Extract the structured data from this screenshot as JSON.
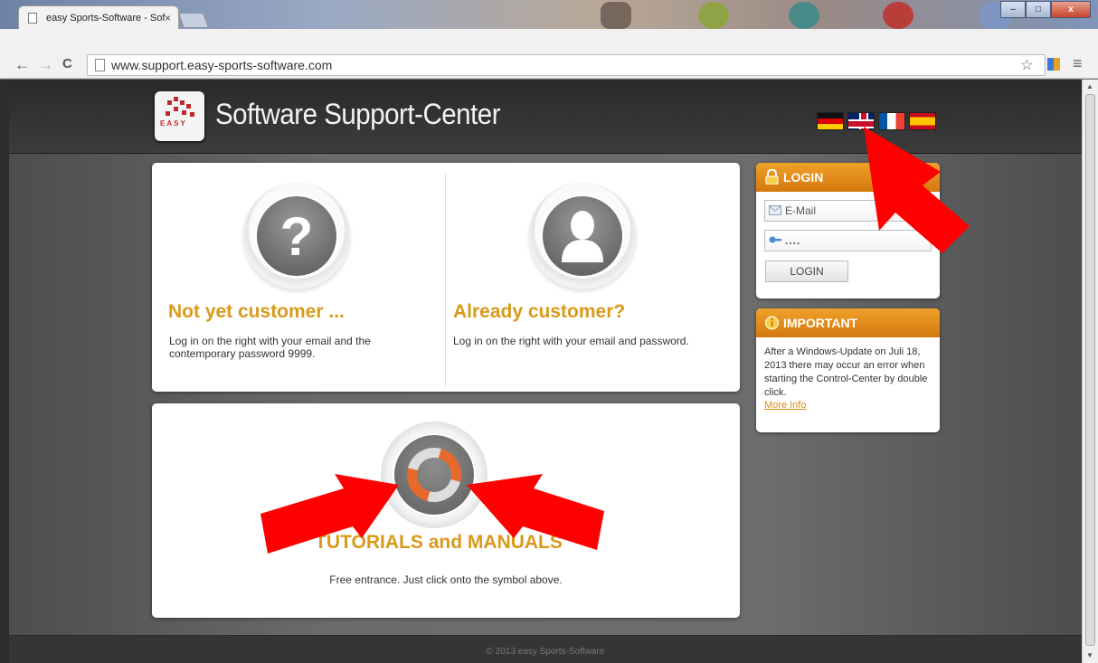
{
  "browser": {
    "tab_title": "easy Sports-Software - Sof",
    "tab_close": "×",
    "url": "www.support.easy-sports-software.com",
    "window_buttons": {
      "minimize": "–",
      "maximize": "□",
      "close": "x"
    },
    "nav": {
      "back": "←",
      "forward": "→",
      "reload": "C"
    },
    "toolbar_icons": {
      "bookmark": "☆",
      "menu": "≡"
    }
  },
  "header": {
    "logo_text": "EASY",
    "title": "Software Support-Center",
    "languages": [
      "German",
      "English",
      "French",
      "Spanish"
    ]
  },
  "cards": {
    "not_customer": {
      "icon": "question-icon",
      "glyph": "?",
      "title": "Not yet customer ...",
      "text": "Log in on the right with your email and the contemporary password 9999."
    },
    "already_customer": {
      "icon": "user-icon",
      "title": "Already customer?",
      "text": "Log in on the right with your email and password."
    },
    "tutorials": {
      "icon": "lifebuoy-icon",
      "title": "TUTORIALS and MANUALS",
      "text": "Free entrance. Just click onto the symbol above."
    }
  },
  "login": {
    "title": "LOGIN",
    "email_placeholder": "E-Mail",
    "password_value": "....",
    "button": "LOGIN"
  },
  "important": {
    "title": "IMPORTANT",
    "text": "After a Windows-Update on Juli 18, 2013 there may occur an error when starting the Control-Center by double click.",
    "link": "More Info"
  },
  "footer": {
    "text": "© 2013 easy Sports-Software"
  },
  "colors": {
    "accent": "#d99a1a",
    "header_orange": "#e58a16",
    "annotation": "#ff0000"
  }
}
